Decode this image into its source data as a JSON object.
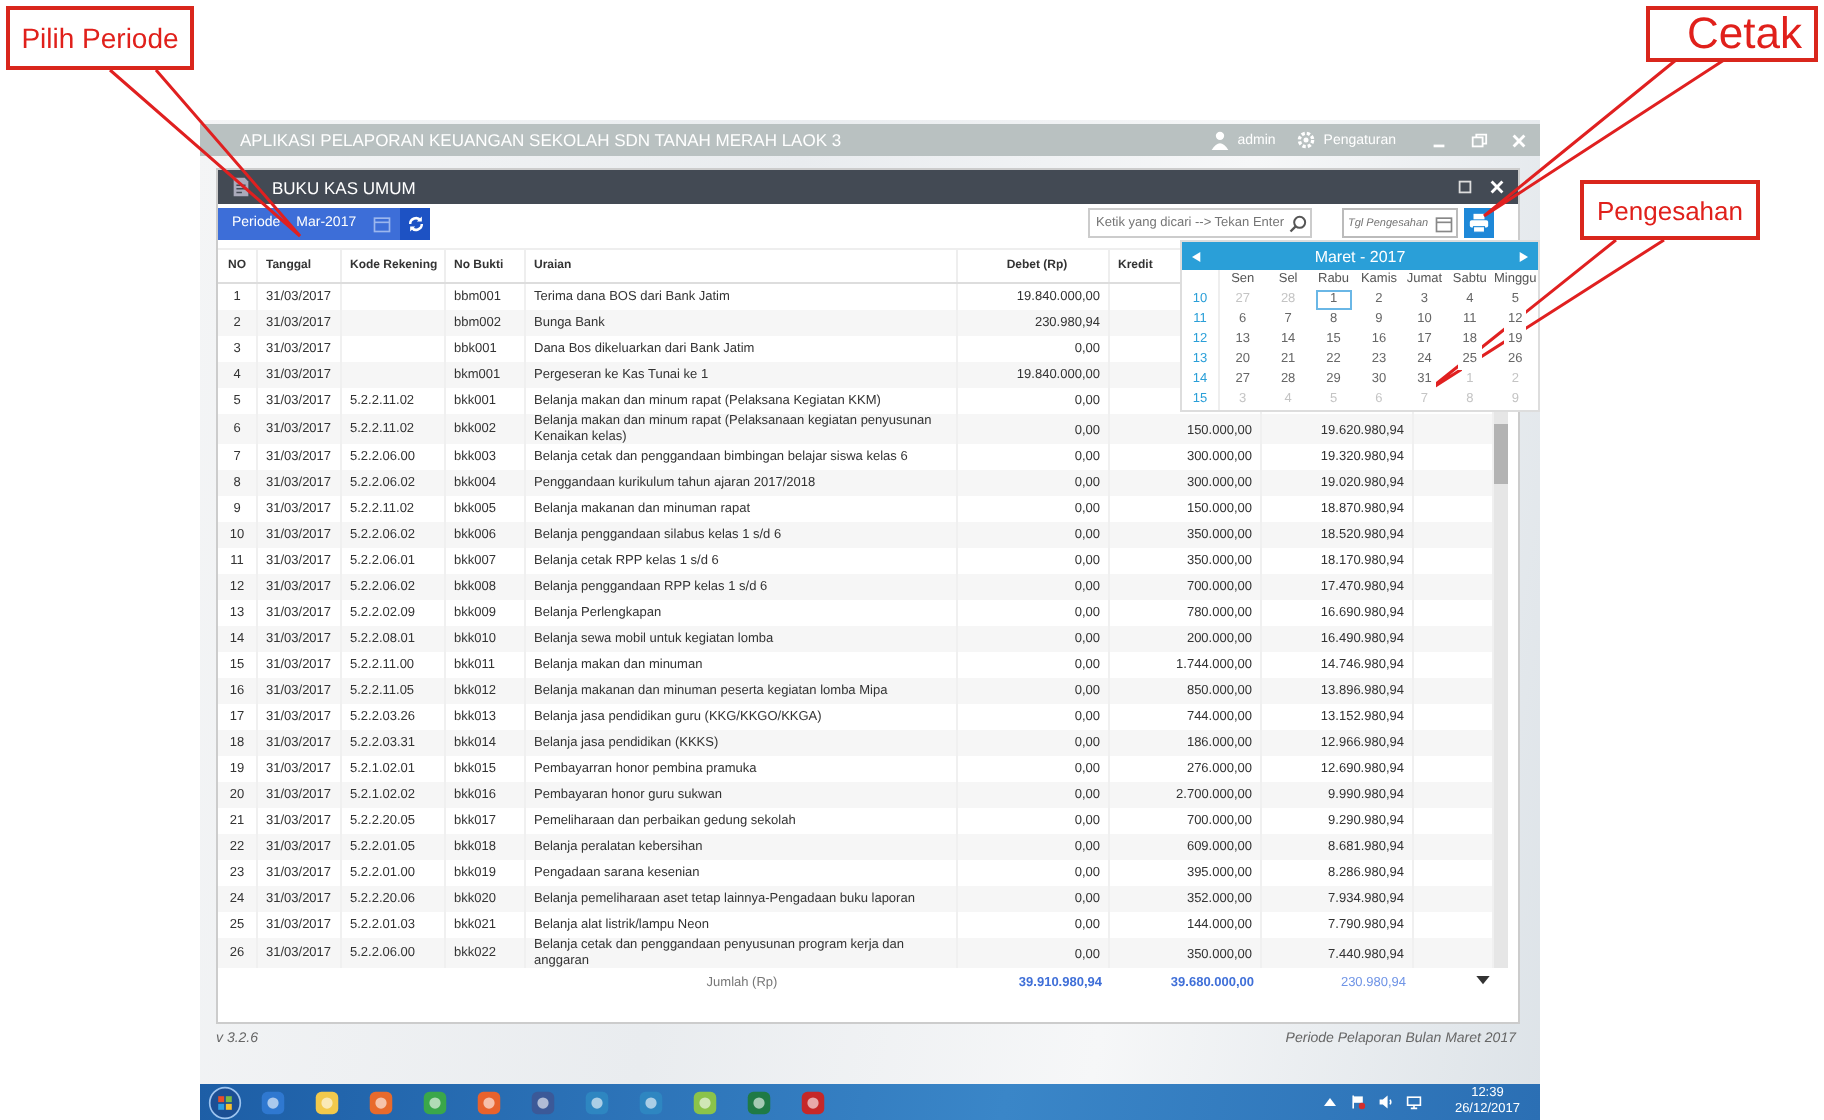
{
  "callouts": [
    {
      "text": "Pilih Periode"
    },
    {
      "text": "Cetak"
    },
    {
      "text": "Pengesahan"
    }
  ],
  "app": {
    "title": "APLIKASI PELAPORAN KEUANGAN SEKOLAH SDN TANAH MERAH LAOK 3",
    "user": "admin",
    "settings": "Pengaturan"
  },
  "window": {
    "title": "BUKU KAS UMUM"
  },
  "toolbar": {
    "period_label": "Periode",
    "period_value": "Mar-2017",
    "search": {
      "placeholder": "Ketik yang dicari --> Tekan Enter"
    },
    "approval_date": {
      "placeholder": "Tgl Pengesahan"
    }
  },
  "table": {
    "columns": [
      "NO",
      "Tanggal",
      "Kode Rekening",
      "No Bukti",
      "Uraian",
      "Debet (Rp)",
      "Kredit"
    ],
    "rows": [
      {
        "no": "1",
        "date": "31/03/2017",
        "voucher": "bbm001",
        "description": "Terima dana BOS dari Bank Jatim",
        "debit": "19.840.000,00"
      },
      {
        "no": "2",
        "date": "31/03/2017",
        "voucher": "bbm002",
        "description": "Bunga Bank",
        "debit": "230.980,94"
      },
      {
        "no": "3",
        "date": "31/03/2017",
        "voucher": "bbk001",
        "description": "Dana Bos dikeluarkan dari Bank Jatim",
        "debit": "0,00"
      },
      {
        "no": "4",
        "date": "31/03/2017",
        "voucher": "bkm001",
        "description": "Pergeseran ke Kas Tunai ke 1",
        "debit": "19.840.000,00"
      },
      {
        "no": "5",
        "date": "31/03/2017",
        "account": "5.2.2.11.02",
        "voucher": "bkk001",
        "description": "Belanja makan dan minum rapat (Pelaksana Kegiatan KKM)",
        "debit": "0,00"
      },
      {
        "no": "6",
        "date": "31/03/2017",
        "account": "5.2.2.11.02",
        "voucher": "bkk002",
        "description": "Belanja makan dan minum rapat (Pelaksanaan kegiatan penyusunan Kenaikan kelas)",
        "debit": "0,00",
        "credit": "150.000,00",
        "balance": "19.620.980,94"
      },
      {
        "no": "7",
        "date": "31/03/2017",
        "account": "5.2.2.06.00",
        "voucher": "bkk003",
        "description": "Belanja cetak dan penggandaan bimbingan belajar siswa kelas 6",
        "debit": "0,00",
        "credit": "300.000,00",
        "balance": "19.320.980,94"
      },
      {
        "no": "8",
        "date": "31/03/2017",
        "account": "5.2.2.06.02",
        "voucher": "bkk004",
        "description": "Penggandaan kurikulum tahun ajaran 2017/2018",
        "debit": "0,00",
        "credit": "300.000,00",
        "balance": "19.020.980,94"
      },
      {
        "no": "9",
        "date": "31/03/2017",
        "account": "5.2.2.11.02",
        "voucher": "bkk005",
        "description": "Belanja makanan dan minuman rapat",
        "debit": "0,00",
        "credit": "150.000,00",
        "balance": "18.870.980,94"
      },
      {
        "no": "10",
        "date": "31/03/2017",
        "account": "5.2.2.06.02",
        "voucher": "bkk006",
        "description": "Belanja penggandaan silabus kelas 1 s/d 6",
        "debit": "0,00",
        "credit": "350.000,00",
        "balance": "18.520.980,94"
      },
      {
        "no": "11",
        "date": "31/03/2017",
        "account": "5.2.2.06.01",
        "voucher": "bkk007",
        "description": "Belanja cetak RPP kelas 1 s/d 6",
        "debit": "0,00",
        "credit": "350.000,00",
        "balance": "18.170.980,94"
      },
      {
        "no": "12",
        "date": "31/03/2017",
        "account": "5.2.2.06.02",
        "voucher": "bkk008",
        "description": "Belanja penggandaan RPP kelas 1 s/d 6",
        "debit": "0,00",
        "credit": "700.000,00",
        "balance": "17.470.980,94"
      },
      {
        "no": "13",
        "date": "31/03/2017",
        "account": "5.2.2.02.09",
        "voucher": "bkk009",
        "description": "Belanja Perlengkapan",
        "debit": "0,00",
        "credit": "780.000,00",
        "balance": "16.690.980,94"
      },
      {
        "no": "14",
        "date": "31/03/2017",
        "account": "5.2.2.08.01",
        "voucher": "bkk010",
        "description": "Belanja sewa mobil untuk kegiatan lomba",
        "debit": "0,00",
        "credit": "200.000,00",
        "balance": "16.490.980,94"
      },
      {
        "no": "15",
        "date": "31/03/2017",
        "account": "5.2.2.11.00",
        "voucher": "bkk011",
        "description": "Belanja makan dan minuman",
        "debit": "0,00",
        "credit": "1.744.000,00",
        "balance": "14.746.980,94"
      },
      {
        "no": "16",
        "date": "31/03/2017",
        "account": "5.2.2.11.05",
        "voucher": "bkk012",
        "description": "Belanja makanan dan minuman peserta kegiatan lomba Mipa",
        "debit": "0,00",
        "credit": "850.000,00",
        "balance": "13.896.980,94"
      },
      {
        "no": "17",
        "date": "31/03/2017",
        "account": "5.2.2.03.26",
        "voucher": "bkk013",
        "description": "Belanja jasa pendidikan guru (KKG/KKGO/KKGA)",
        "debit": "0,00",
        "credit": "744.000,00",
        "balance": "13.152.980,94"
      },
      {
        "no": "18",
        "date": "31/03/2017",
        "account": "5.2.2.03.31",
        "voucher": "bkk014",
        "description": "Belanja jasa pendidikan (KKKS)",
        "debit": "0,00",
        "credit": "186.000,00",
        "balance": "12.966.980,94"
      },
      {
        "no": "19",
        "date": "31/03/2017",
        "account": "5.2.1.02.01",
        "voucher": "bkk015",
        "description": "Pembayarran honor pembina pramuka",
        "debit": "0,00",
        "credit": "276.000,00",
        "balance": "12.690.980,94"
      },
      {
        "no": "20",
        "date": "31/03/2017",
        "account": "5.2.1.02.02",
        "voucher": "bkk016",
        "description": "Pembayaran honor guru sukwan",
        "debit": "0,00",
        "credit": "2.700.000,00",
        "balance": "9.990.980,94"
      },
      {
        "no": "21",
        "date": "31/03/2017",
        "account": "5.2.2.20.05",
        "voucher": "bkk017",
        "description": "Pemeliharaan dan perbaikan gedung sekolah",
        "debit": "0,00",
        "credit": "700.000,00",
        "balance": "9.290.980,94"
      },
      {
        "no": "22",
        "date": "31/03/2017",
        "account": "5.2.2.01.05",
        "voucher": "bkk018",
        "description": "Belanja peralatan kebersihan",
        "debit": "0,00",
        "credit": "609.000,00",
        "balance": "8.681.980,94"
      },
      {
        "no": "23",
        "date": "31/03/2017",
        "account": "5.2.2.01.00",
        "voucher": "bkk019",
        "description": "Pengadaan sarana kesenian",
        "debit": "0,00",
        "credit": "395.000,00",
        "balance": "8.286.980,94"
      },
      {
        "no": "24",
        "date": "31/03/2017",
        "account": "5.2.2.20.06",
        "voucher": "bkk020",
        "description": "Belanja pemeliharaan aset tetap lainnya-Pengadaan buku laporan",
        "debit": "0,00",
        "credit": "352.000,00",
        "balance": "7.934.980,94"
      },
      {
        "no": "25",
        "date": "31/03/2017",
        "account": "5.2.2.01.03",
        "voucher": "bkk021",
        "description": "Belanja alat listrik/lampu Neon",
        "debit": "0,00",
        "credit": "144.000,00",
        "balance": "7.790.980,94"
      },
      {
        "no": "26",
        "date": "31/03/2017",
        "account": "5.2.2.06.00",
        "voucher": "bkk022",
        "description": "Belanja cetak dan penggandaan penyusunan program kerja dan anggaran",
        "debit": "0,00",
        "credit": "350.000,00",
        "balance": "7.440.980,94"
      }
    ],
    "total": {
      "label": "Jumlah (Rp)",
      "debit": "39.910.980,94",
      "credit": "39.680.000,00",
      "balance": "230.980,94"
    }
  },
  "calendar": {
    "title": "Maret - 2017",
    "weekdays": [
      "Sen",
      "Sel",
      "Rabu",
      "Kamis",
      "Jumat",
      "Sabtu",
      "Minggu"
    ],
    "weeks": [
      {
        "number": "10",
        "days": [
          {
            "day": "27",
            "in_month": false,
            "selected": false
          },
          {
            "day": "28",
            "in_month": false,
            "selected": false
          },
          {
            "day": "1",
            "in_month": true,
            "selected": true
          },
          {
            "day": "2",
            "in_month": true,
            "selected": false
          },
          {
            "day": "3",
            "in_month": true,
            "selected": false
          },
          {
            "day": "4",
            "in_month": true,
            "selected": false
          },
          {
            "day": "5",
            "in_month": true,
            "selected": false
          }
        ]
      },
      {
        "number": "11",
        "days": [
          {
            "day": "6",
            "in_month": true,
            "selected": false
          },
          {
            "day": "7",
            "in_month": true,
            "selected": false
          },
          {
            "day": "8",
            "in_month": true,
            "selected": false
          },
          {
            "day": "9",
            "in_month": true,
            "selected": false
          },
          {
            "day": "10",
            "in_month": true,
            "selected": false
          },
          {
            "day": "11",
            "in_month": true,
            "selected": false
          },
          {
            "day": "12",
            "in_month": true,
            "selected": false
          }
        ]
      },
      {
        "number": "12",
        "days": [
          {
            "day": "13",
            "in_month": true,
            "selected": false
          },
          {
            "day": "14",
            "in_month": true,
            "selected": false
          },
          {
            "day": "15",
            "in_month": true,
            "selected": false
          },
          {
            "day": "16",
            "in_month": true,
            "selected": false
          },
          {
            "day": "17",
            "in_month": true,
            "selected": false
          },
          {
            "day": "18",
            "in_month": true,
            "selected": false
          },
          {
            "day": "19",
            "in_month": true,
            "selected": false
          }
        ]
      },
      {
        "number": "13",
        "days": [
          {
            "day": "20",
            "in_month": true,
            "selected": false
          },
          {
            "day": "21",
            "in_month": true,
            "selected": false
          },
          {
            "day": "22",
            "in_month": true,
            "selected": false
          },
          {
            "day": "23",
            "in_month": true,
            "selected": false
          },
          {
            "day": "24",
            "in_month": true,
            "selected": false
          },
          {
            "day": "25",
            "in_month": true,
            "selected": false
          },
          {
            "day": "26",
            "in_month": true,
            "selected": false
          }
        ]
      },
      {
        "number": "14",
        "days": [
          {
            "day": "27",
            "in_month": true,
            "selected": false
          },
          {
            "day": "28",
            "in_month": true,
            "selected": false
          },
          {
            "day": "29",
            "in_month": true,
            "selected": false
          },
          {
            "day": "30",
            "in_month": true,
            "selected": false
          },
          {
            "day": "31",
            "in_month": true,
            "selected": false
          },
          {
            "day": "1",
            "in_month": false,
            "selected": false
          },
          {
            "day": "2",
            "in_month": false,
            "selected": false
          }
        ]
      },
      {
        "number": "15",
        "days": [
          {
            "day": "3",
            "in_month": false,
            "selected": false
          },
          {
            "day": "4",
            "in_month": false,
            "selected": false
          },
          {
            "day": "5",
            "in_month": false,
            "selected": false
          },
          {
            "day": "6",
            "in_month": false,
            "selected": false
          },
          {
            "day": "7",
            "in_month": false,
            "selected": false
          },
          {
            "day": "8",
            "in_month": false,
            "selected": false
          },
          {
            "day": "9",
            "in_month": false,
            "selected": false
          }
        ]
      }
    ]
  },
  "footer": {
    "version": "v 3.2.6",
    "period": "Periode Pelaporan Bulan Maret 2017"
  },
  "taskbar": {
    "time": "12:39",
    "date": "26/12/2017"
  }
}
